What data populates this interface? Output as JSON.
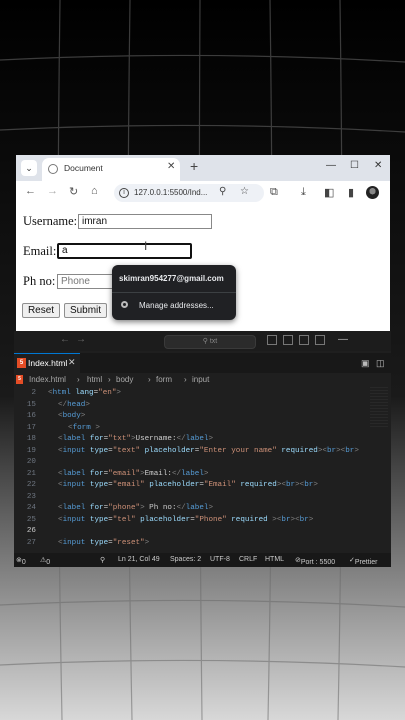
{
  "browser": {
    "tab_title": "Document",
    "url": "127.0.0.1:5500/Ind...",
    "win_min": "—",
    "win_max": "☐",
    "win_close": "✕"
  },
  "form": {
    "username_label": "Username:",
    "username_value": "imran",
    "email_label": "Email:",
    "email_value": "a",
    "phone_label": "Ph no:",
    "phone_placeholder": "Phone",
    "reset_label": "Reset",
    "submit_label": "Submit"
  },
  "autofill": {
    "email": "skimran954277@gmail.com",
    "manage": "Manage addresses..."
  },
  "editor": {
    "search_placeholder": "txt",
    "tab_name": "Index.html",
    "html_badge": "5",
    "breadcrumbs": [
      "Index.html",
      "html",
      "body",
      "form",
      "input"
    ],
    "line_numbers": [
      "2",
      "15",
      "16",
      "17",
      "18",
      "19",
      "20",
      "21",
      "22",
      "23",
      "24",
      "25",
      "26",
      "27",
      "28"
    ],
    "active_line": "21",
    "status": {
      "errors": "0",
      "warnings": "0",
      "position": "Ln 21, Col 49",
      "spaces": "Spaces: 2",
      "encoding": "UTF-8",
      "eol": "CRLF",
      "language": "HTML",
      "port": "Port : 5500",
      "formatter": "Prettier"
    }
  },
  "colors": {
    "vscode_bg": "#1f1f1f",
    "tag": "#569cd6",
    "attr": "#9cdcfe",
    "string": "#ce9178",
    "html_icon": "#e44d26"
  }
}
